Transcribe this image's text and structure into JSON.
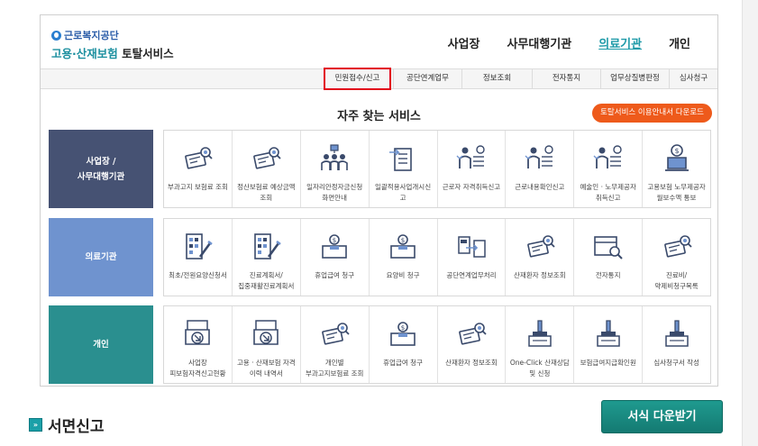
{
  "header": {
    "org": "근로복지공단",
    "title_part1": "고용·산재보험",
    "title_part2": "토탈서비스",
    "nav": [
      "사업장",
      "사무대행기관",
      "의료기관",
      "개인"
    ]
  },
  "subnav": [
    "민원접수/신고",
    "공단연계업무",
    "정보조회",
    "전자통지",
    "업무상질병판정",
    "심사청구"
  ],
  "section": {
    "title": "자주 찾는 서비스",
    "guide_button": "토탈서비스 이용안내서 다운로드"
  },
  "rows": [
    {
      "label_line1": "사업장 /",
      "label_line2": "사무대행기관",
      "color": "#465273",
      "items": [
        {
          "label": "부과고지 보험료 조회",
          "icon": "card-search-icon"
        },
        {
          "label": "정산보험료 예상금액 조회",
          "icon": "card-search-icon"
        },
        {
          "label": "일자리안정자금신청화면안내",
          "icon": "org-chart-icon"
        },
        {
          "label": "일괄적용사업개시신고",
          "icon": "document-arrow-icon"
        },
        {
          "label": "근로자 자격취득신고",
          "icon": "person-list-icon"
        },
        {
          "label": "근로내용확인신고",
          "icon": "person-list-icon"
        },
        {
          "label": "예술인 · 노무제공자 취득신고",
          "icon": "person-list-icon"
        },
        {
          "label": "고용보험 노무제공자 월보수액 통보",
          "icon": "money-pot-icon"
        }
      ]
    },
    {
      "label_line1": "의료기관",
      "label_line2": "",
      "color": "#6f93cf",
      "items": [
        {
          "label": "최초/전원요양신청서",
          "icon": "form-pen-icon"
        },
        {
          "label": "진료계획서/집중재활진료계획서",
          "icon": "form-pen-icon"
        },
        {
          "label": "휴업급여 청구",
          "icon": "money-box-icon"
        },
        {
          "label": "요양비 청구",
          "icon": "money-box-icon"
        },
        {
          "label": "공단연계업무처리",
          "icon": "exchange-icon"
        },
        {
          "label": "산재환자 정보조회",
          "icon": "card-search-icon"
        },
        {
          "label": "전자통지",
          "icon": "box-search-icon"
        },
        {
          "label": "진료비/약제비청구목록",
          "icon": "card-search-icon"
        }
      ]
    },
    {
      "label_line1": "개인",
      "label_line2": "",
      "color": "#2a8f8f",
      "items": [
        {
          "label": "사업장 피보험자격신고현황",
          "icon": "tray-arrow-icon"
        },
        {
          "label": "고용 · 산재보험 자격 이력 내역서",
          "icon": "tray-arrow-icon"
        },
        {
          "label": "개인별 부과고지보험료 조회",
          "icon": "card-search-icon"
        },
        {
          "label": "휴업급여 청구",
          "icon": "money-box-icon"
        },
        {
          "label": "산재환자 정보조회",
          "icon": "card-search-icon"
        },
        {
          "label": "One-Click 산재상담 및 신청",
          "icon": "stamp-icon"
        },
        {
          "label": "보험급여지급확인원",
          "icon": "stamp-icon"
        },
        {
          "label": "심사청구서 작성",
          "icon": "stamp-icon"
        }
      ]
    }
  ],
  "bottom": {
    "title": "서면신고",
    "download_button": "서식 다운받기"
  }
}
